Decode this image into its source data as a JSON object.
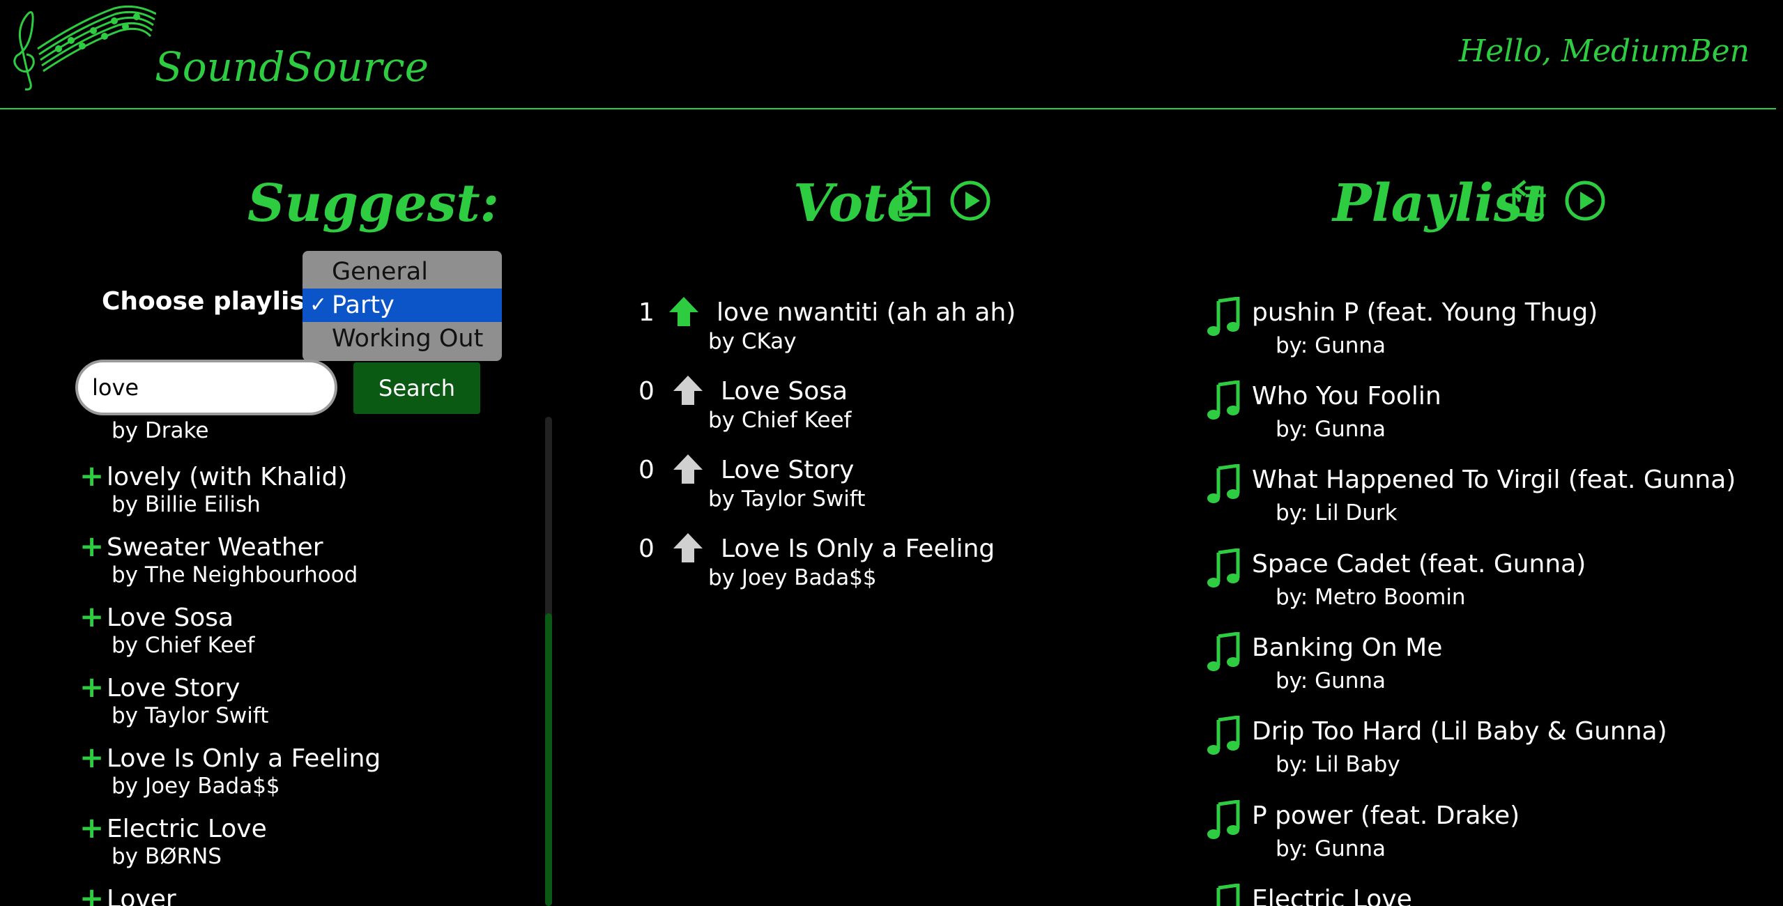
{
  "app": {
    "brand": "SoundSource",
    "greeting": "Hello, MediumBen",
    "accent_color": "#2ecc40"
  },
  "suggest": {
    "title": "Suggest:",
    "choose_label": "Choose playlist:",
    "playlist_options": [
      "General",
      "Party",
      "Working Out"
    ],
    "selected_option": "Party",
    "search_value": "love",
    "search_button": "Search",
    "results": [
      {
        "title": "",
        "artist": "by Drake"
      },
      {
        "title": "lovely (with Khalid)",
        "artist": "by Billie Eilish"
      },
      {
        "title": "Sweater Weather",
        "artist": "by The Neighbourhood"
      },
      {
        "title": "Love Sosa",
        "artist": "by Chief Keef"
      },
      {
        "title": "Love Story",
        "artist": "by Taylor Swift"
      },
      {
        "title": "Love Is Only a Feeling",
        "artist": "by Joey Bada$$"
      },
      {
        "title": "Electric Love",
        "artist": "by BØRNS"
      },
      {
        "title": "Lover",
        "artist": ""
      }
    ]
  },
  "vote": {
    "title": "Vote",
    "items": [
      {
        "count": "1",
        "voted": true,
        "title": "love nwantiti (ah ah ah)",
        "artist": "by CKay"
      },
      {
        "count": "0",
        "voted": false,
        "title": "Love Sosa",
        "artist": "by Chief Keef"
      },
      {
        "count": "0",
        "voted": false,
        "title": "Love Story",
        "artist": "by Taylor Swift"
      },
      {
        "count": "0",
        "voted": false,
        "title": "Love Is Only a Feeling",
        "artist": "by Joey Bada$$"
      }
    ]
  },
  "playlist": {
    "title": "Playlist",
    "items": [
      {
        "title": "pushin P (feat. Young Thug)",
        "artist": "by: Gunna"
      },
      {
        "title": "Who You Foolin",
        "artist": "by: Gunna"
      },
      {
        "title": "What Happened To Virgil (feat. Gunna)",
        "artist": "by: Lil Durk"
      },
      {
        "title": "Space Cadet (feat. Gunna)",
        "artist": "by: Metro Boomin"
      },
      {
        "title": "Banking On Me",
        "artist": "by: Gunna"
      },
      {
        "title": "Drip Too Hard (Lil Baby & Gunna)",
        "artist": "by: Lil Baby"
      },
      {
        "title": "P power (feat. Drake)",
        "artist": "by: Gunna"
      },
      {
        "title": "Electric Love",
        "artist": ""
      }
    ]
  }
}
